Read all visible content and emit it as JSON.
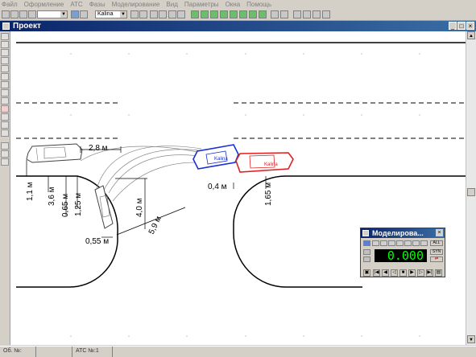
{
  "menu": [
    "Файл",
    "Оформление",
    "АТС",
    "Фазы",
    "Моделирование",
    "Вид",
    "Параметры",
    "Окна",
    "Помощь"
  ],
  "toolbar": {
    "vehicle_select": "Kalina"
  },
  "window": {
    "title": "Проект",
    "min": "_",
    "max": "□",
    "close": "×"
  },
  "diagram": {
    "dims": {
      "d1": "2,8 м",
      "d2": "1,1 м",
      "d3": "3,6 м",
      "d4": "0,65 м",
      "d5": "1,25 м",
      "d6": "4,0 м",
      "d7": "5,9 м",
      "d8": "0,55 м",
      "d9": "0,4 м",
      "d10": "1,65 м"
    },
    "cars": {
      "blue": "Kalina",
      "red": "Kalina"
    }
  },
  "sim": {
    "title": "Моделирова...",
    "close": "×",
    "time": "0.000",
    "all": "ALL",
    "syn": "SYN"
  },
  "status": {
    "p1": "Об. №:",
    "p2": "",
    "p3": "АТС №:1"
  }
}
